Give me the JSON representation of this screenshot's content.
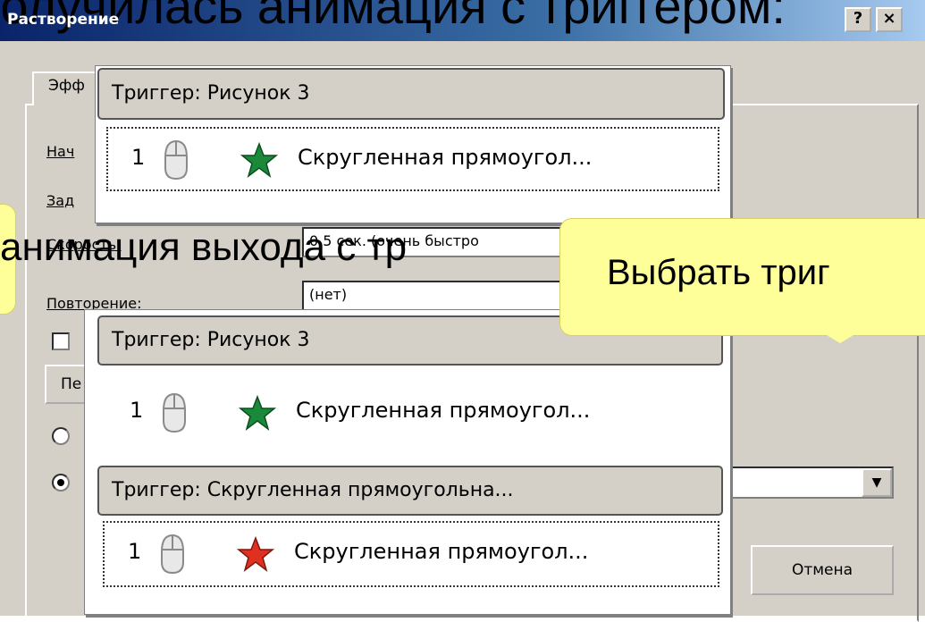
{
  "slide_title": "получилась анимация с триггером:",
  "dialog": {
    "title": "Растворение",
    "help_label": "?",
    "close_label": "×",
    "tab_label": "Эфф",
    "labels": {
      "start": "Нач",
      "delay": "Зад",
      "speed": "Скорость:",
      "repeat": "Повторение:"
    },
    "speed_value": "0,5 сек. (очень быстро",
    "repeat_value": "(нет)",
    "partial_button": "Пе",
    "dropdown_arrow": "▼",
    "cancel_label": "Отмена"
  },
  "popup1": {
    "trigger_label": "Триггер: Рисунок 3",
    "items": [
      {
        "number": "1",
        "icon": "mouse-icon",
        "effect_icon": "green-star-icon",
        "text": "Скругленная прямоугол..."
      }
    ]
  },
  "popup2": {
    "groups": [
      {
        "trigger_label": "Триггер: Рисунок 3",
        "items": [
          {
            "number": "1",
            "icon": "mouse-icon",
            "effect_icon": "green-star-icon",
            "text": "Скругленная прямоугол..."
          }
        ]
      },
      {
        "trigger_label": "Триггер: Скругленная прямоугольна...",
        "items": [
          {
            "number": "1",
            "icon": "mouse-icon",
            "effect_icon": "red-star-icon",
            "text": "Скругленная прямоугол..."
          }
        ]
      }
    ]
  },
  "callouts": {
    "left": "анимация выхода с тр",
    "right": "Выбрать триг"
  },
  "colors": {
    "green_star": "#1a8a3a",
    "red_star": "#e03020",
    "callout_bg": "#ffff99",
    "dialog_bg": "#d4d0c8"
  }
}
